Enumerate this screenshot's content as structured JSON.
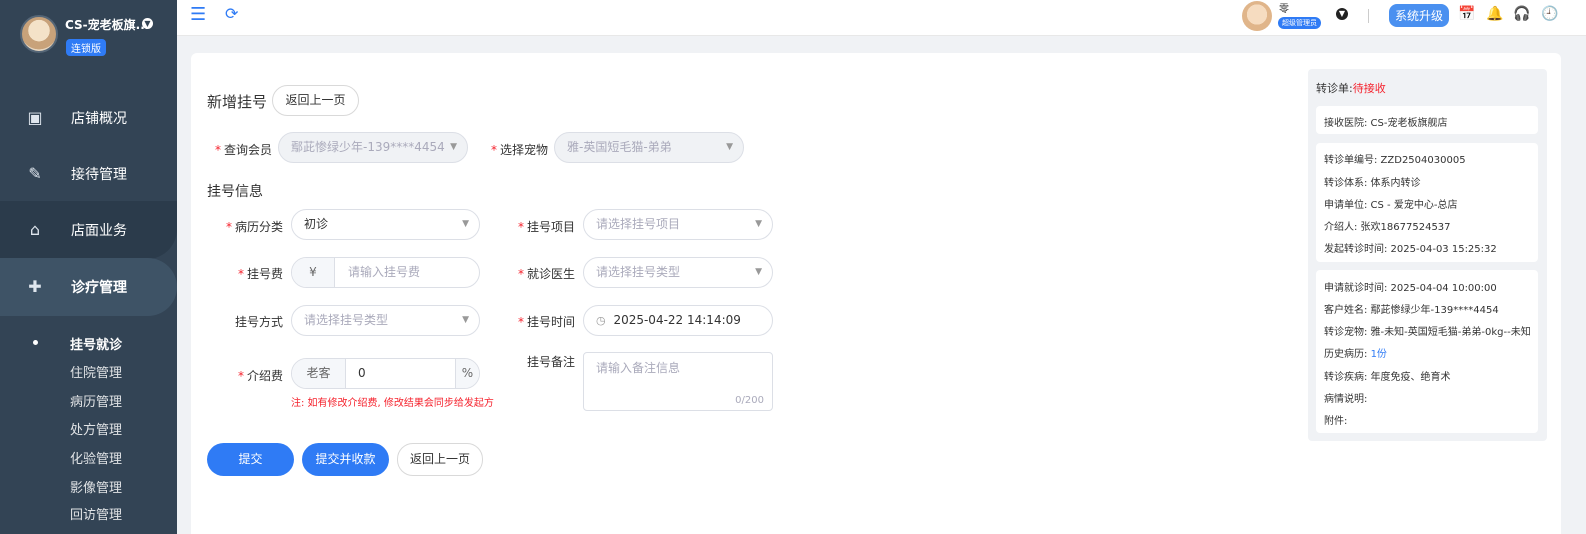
{
  "sidebar": {
    "store_name": "CS-宠老板旗...",
    "store_badge": "连锁版",
    "nav": [
      {
        "label": "店铺概况",
        "icon": "dashboard-icon"
      },
      {
        "label": "接待管理",
        "icon": "reception-icon"
      },
      {
        "label": "店面业务",
        "icon": "store-icon"
      },
      {
        "label": "诊疗管理",
        "icon": "medical-kit-icon"
      }
    ],
    "sub_items": [
      "挂号就诊",
      "住院管理",
      "病历管理",
      "处方管理",
      "化验管理",
      "影像管理",
      "回访管理"
    ]
  },
  "topbar": {
    "user_name": "零",
    "user_role": "超级管理员",
    "upgrade_label": "系统升级"
  },
  "form": {
    "title": "新增挂号",
    "back_label": "返回上一页",
    "member_label": "查询会员",
    "member_value": "鄢茈惨绿少年-139****4454",
    "pet_label": "选择宠物",
    "pet_value": "雅-英国短毛猫-弟弟",
    "section_title": "挂号信息",
    "record_type_label": "病历分类",
    "record_type_value": "初诊",
    "item_label": "挂号项目",
    "item_placeholder": "请选择挂号项目",
    "fee_label": "挂号费",
    "fee_prefix": "¥",
    "fee_placeholder": "请输入挂号费",
    "doctor_label": "就诊医生",
    "doctor_placeholder": "请选择挂号类型",
    "method_label": "挂号方式",
    "method_placeholder": "请选择挂号类型",
    "time_label": "挂号时间",
    "time_value": "2025-04-22 14:14:09",
    "referral_fee_label": "介绍费",
    "referral_fee_prefix": "老客",
    "referral_fee_value": "0",
    "referral_fee_suffix": "%",
    "referral_note": "注: 如有修改介绍费, 修改结果会同步给发起方",
    "remark_label": "挂号备注",
    "remark_placeholder": "请输入备注信息",
    "remark_count": "0/200",
    "submit_label": "提交",
    "submit_pay_label": "提交并收款",
    "back_bottom_label": "返回上一页"
  },
  "referral": {
    "head_label": "转诊单:",
    "head_status": "待接收",
    "receive_hospital": "接收医院: CS-宠老板旗舰店",
    "rows_a": [
      "转诊单编号: ZZD2504030005",
      "转诊体系: 体系内转诊",
      "申请单位: CS - 爱宠中心-总店",
      "介绍人: 张欢18677524537",
      "发起转诊时间: 2025-04-03 15:25:32"
    ],
    "rows_b": [
      "申请就诊时间: 2025-04-04 10:00:00",
      "客户姓名: 鄢茈惨绿少年-139****4454",
      "转诊宠物: 雅-未知-英国短毛猫-弟弟-0kg--未知"
    ],
    "history_label": "历史病历:",
    "history_link": "1份",
    "rows_c": [
      "转诊疾病: 年度免疫、绝育术",
      "病情说明:",
      "附件:"
    ]
  }
}
